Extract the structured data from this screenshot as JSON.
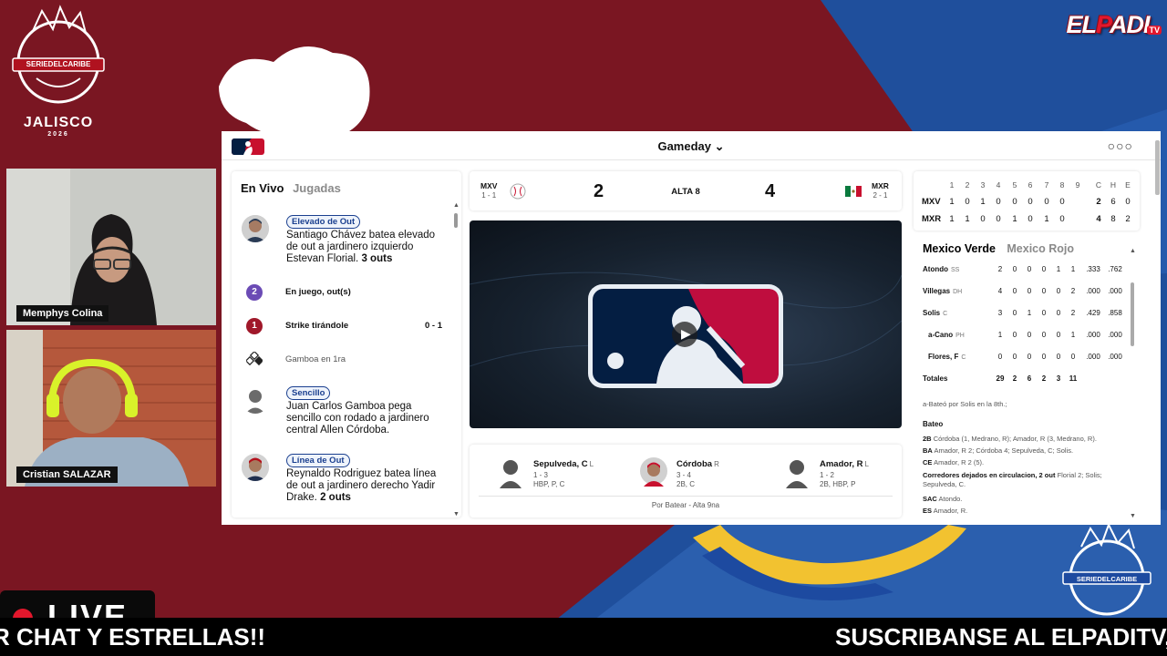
{
  "stream": {
    "brand": {
      "name_left": "EL",
      "name_mid": "P",
      "name_right": "ADI",
      "sup": "TV"
    },
    "event_logo": {
      "name": "SERIEDELCARIBE",
      "city": "JALISCO",
      "year": "2026"
    },
    "hosts": [
      {
        "name": "Memphys Colina"
      },
      {
        "name": "Cristian SALAZAR"
      }
    ],
    "live_label": "LIVE",
    "ticker": [
      "R CHAT Y ESTRELLAS!!",
      "SUSCRIBANSE AL ELPADITV, C"
    ],
    "colors": {
      "maroon": "#7a1622",
      "blue": "#1f4f9c",
      "ticker_bg": "#000000",
      "accent_red": "#e3172c"
    }
  },
  "gameday": {
    "title": "Gameday",
    "menu_icon": "more-icon",
    "feed": {
      "tabs": [
        "En Vivo",
        "Jugadas"
      ],
      "items": [
        {
          "badge": "Elevado de Out",
          "text": "Santiago Chávez batea elevado de out a jardinero izquierdo Estevan Florial.",
          "bold": "3 outs"
        },
        {
          "number": "2",
          "text": "En juego, out(s)"
        },
        {
          "number": "1",
          "text": "Strike tirándole",
          "count": "0 - 1"
        },
        {
          "icon": "base-runner-icon",
          "text": "Gamboa en 1ra"
        },
        {
          "badge": "Sencillo",
          "text": "Juan Carlos Gamboa pega sencillo con rodado a jardinero central Allen Córdoba.",
          "bold": ""
        },
        {
          "badge": "Línea de Out",
          "text": "Reynaldo Rodriguez batea línea de out a jardinero derecho Yadir Drake.",
          "bold": "2 outs"
        }
      ]
    },
    "scoreline": {
      "away": {
        "abbr": "MXV",
        "record": "1 - 1",
        "score": "2"
      },
      "home": {
        "abbr": "MXR",
        "record": "2 - 1",
        "score": "4"
      },
      "inning": "ALTA 8"
    },
    "matchup": {
      "players": [
        {
          "name": "Sepulveda, C",
          "hand": "L",
          "line1": "1 - 3",
          "line2": "HBP, P, C"
        },
        {
          "name": "Córdoba",
          "hand": "R",
          "line1": "3 - 4",
          "line2": "2B, C"
        },
        {
          "name": "Amador, R",
          "hand": "L",
          "line1": "1 - 2",
          "line2": "2B, HBP, P"
        }
      ],
      "footer": "Por Batear - Alta 9na"
    },
    "linescore": {
      "headers": [
        "1",
        "2",
        "3",
        "4",
        "5",
        "6",
        "7",
        "8",
        "9",
        "C",
        "H",
        "E"
      ],
      "rows": [
        {
          "team": "MXV",
          "values": [
            "1",
            "0",
            "1",
            "0",
            "0",
            "0",
            "0",
            "0",
            "",
            "2",
            "6",
            "0"
          ]
        },
        {
          "team": "MXR",
          "values": [
            "1",
            "1",
            "0",
            "0",
            "1",
            "0",
            "1",
            "0",
            "",
            "4",
            "8",
            "2"
          ]
        }
      ]
    },
    "boxscore": {
      "tabs": [
        "Mexico Verde",
        "Mexico Rojo"
      ],
      "rows": [
        {
          "name": "Atondo",
          "pos": "SS",
          "values": [
            "2",
            "0",
            "0",
            "0",
            "1",
            "1",
            ".333",
            ".762"
          ]
        },
        {
          "name": "Villegas",
          "pos": "DH",
          "values": [
            "4",
            "0",
            "0",
            "0",
            "0",
            "2",
            ".000",
            ".000"
          ]
        },
        {
          "name": "Solis",
          "pos": "C",
          "values": [
            "3",
            "0",
            "1",
            "0",
            "0",
            "2",
            ".429",
            ".858"
          ]
        },
        {
          "name": "a-Cano",
          "pos": "PH",
          "values": [
            "1",
            "0",
            "0",
            "0",
            "0",
            "1",
            ".000",
            ".000"
          ]
        },
        {
          "name": "Flores, F",
          "pos": "C",
          "values": [
            "0",
            "0",
            "0",
            "0",
            "0",
            "0",
            ".000",
            ".000"
          ]
        }
      ],
      "totals": {
        "label": "Totales",
        "values": [
          "29",
          "2",
          "6",
          "2",
          "3",
          "11"
        ]
      },
      "footnote": "a-Bateó por Solis en la 8th.;",
      "batting_label": "Bateo",
      "notes": [
        {
          "k": "2B",
          "v": "Córdoba (1, Medrano, R); Amador, R (3, Medrano, R)."
        },
        {
          "k": "BA",
          "v": "Amador, R 2; Córdoba 4; Sepulveda, C; Solis."
        },
        {
          "k": "CE",
          "v": "Amador, R 2 (5)."
        },
        {
          "k": "Corredores dejados en circulacion, 2 out",
          "v": "Florial 2; Solis; Sepulveda, C."
        },
        {
          "k": "SAC",
          "v": "Atondo."
        },
        {
          "k": "ES",
          "v": "Amador, R."
        }
      ]
    }
  }
}
